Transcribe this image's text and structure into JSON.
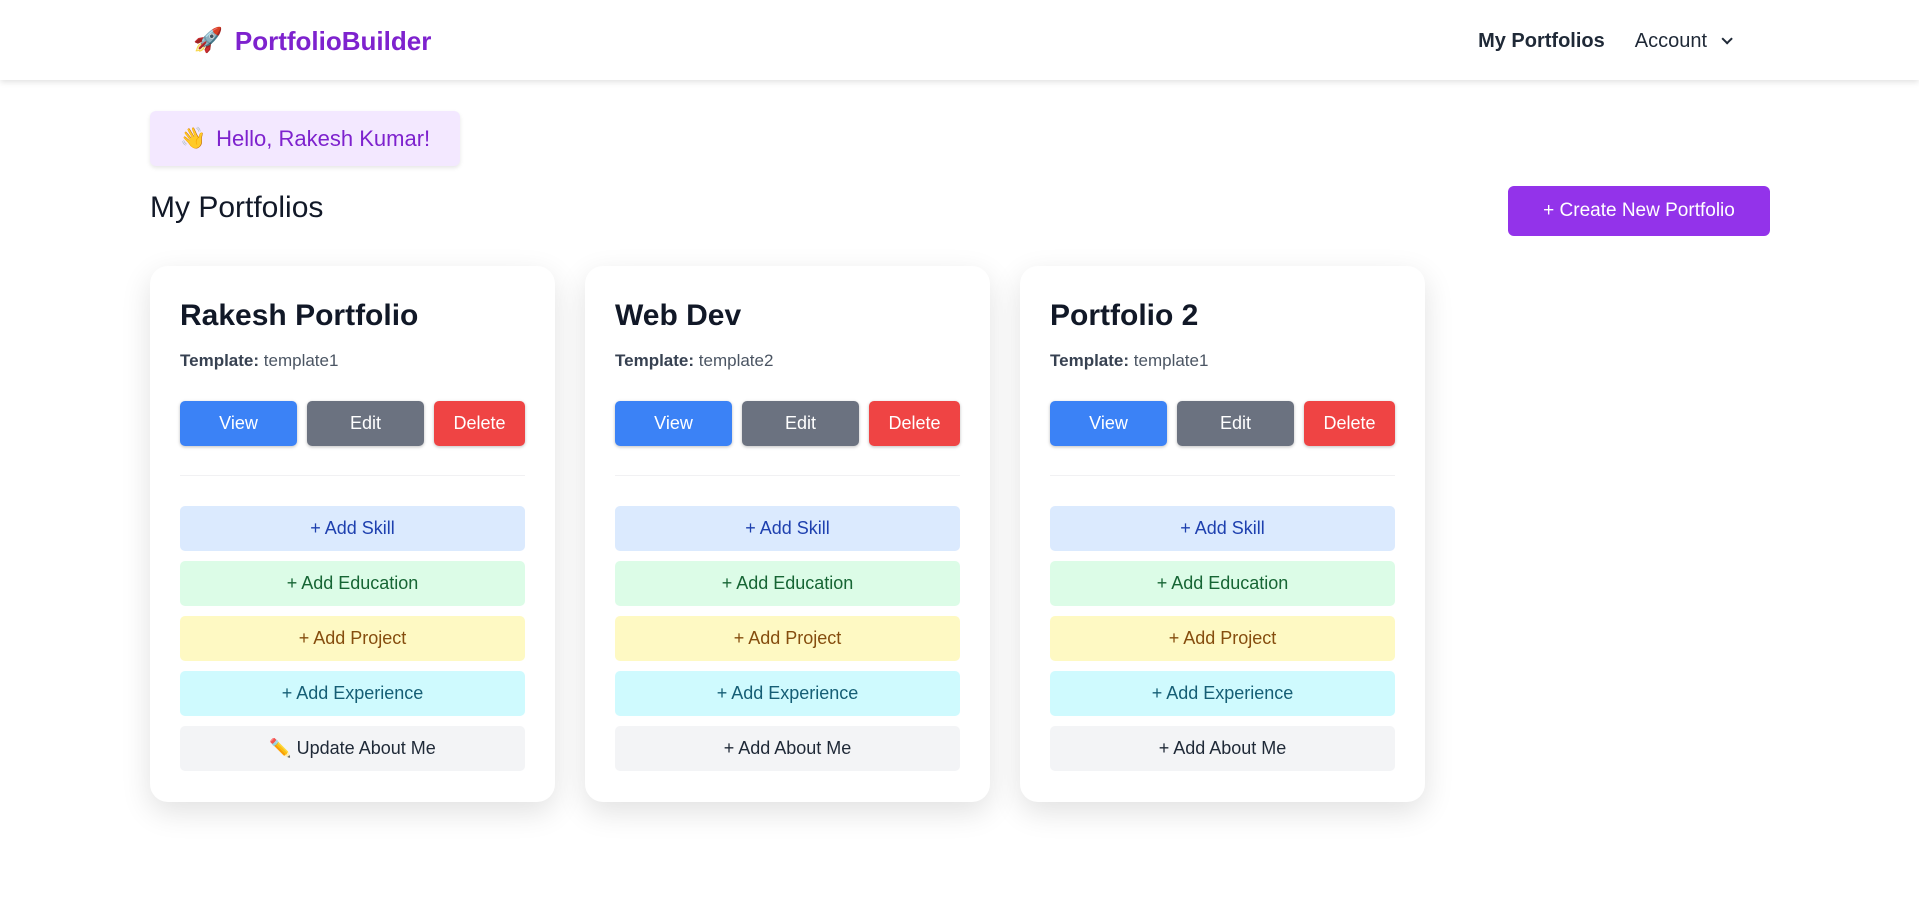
{
  "navbar": {
    "brand_icon": "🚀",
    "brand_name": "PortfolioBuilder",
    "links": {
      "my_portfolios": "My Portfolios",
      "account": "Account"
    }
  },
  "greeting": {
    "icon": "👋",
    "text": "Hello, Rakesh Kumar!"
  },
  "page": {
    "title": "My Portfolios",
    "create_button": "+ Create New Portfolio"
  },
  "labels": {
    "template_label": "Template:",
    "view": "View",
    "edit": "Edit",
    "delete": "Delete",
    "add_skill": "+ Add Skill",
    "add_education": "+ Add Education",
    "add_project": "+ Add Project",
    "add_experience": "+ Add Experience"
  },
  "portfolios": [
    {
      "title": "Rakesh Portfolio",
      "template": "template1",
      "about_label": "✏️ Update About Me"
    },
    {
      "title": "Web Dev",
      "template": "template2",
      "about_label": "+ Add About Me"
    },
    {
      "title": "Portfolio 2",
      "template": "template1",
      "about_label": "+ Add About Me"
    }
  ],
  "colors": {
    "brand": "#7e22ce",
    "primary_button": "#9333ea",
    "view": "#3b82f6",
    "edit": "#6b7280",
    "delete": "#ef4444"
  }
}
